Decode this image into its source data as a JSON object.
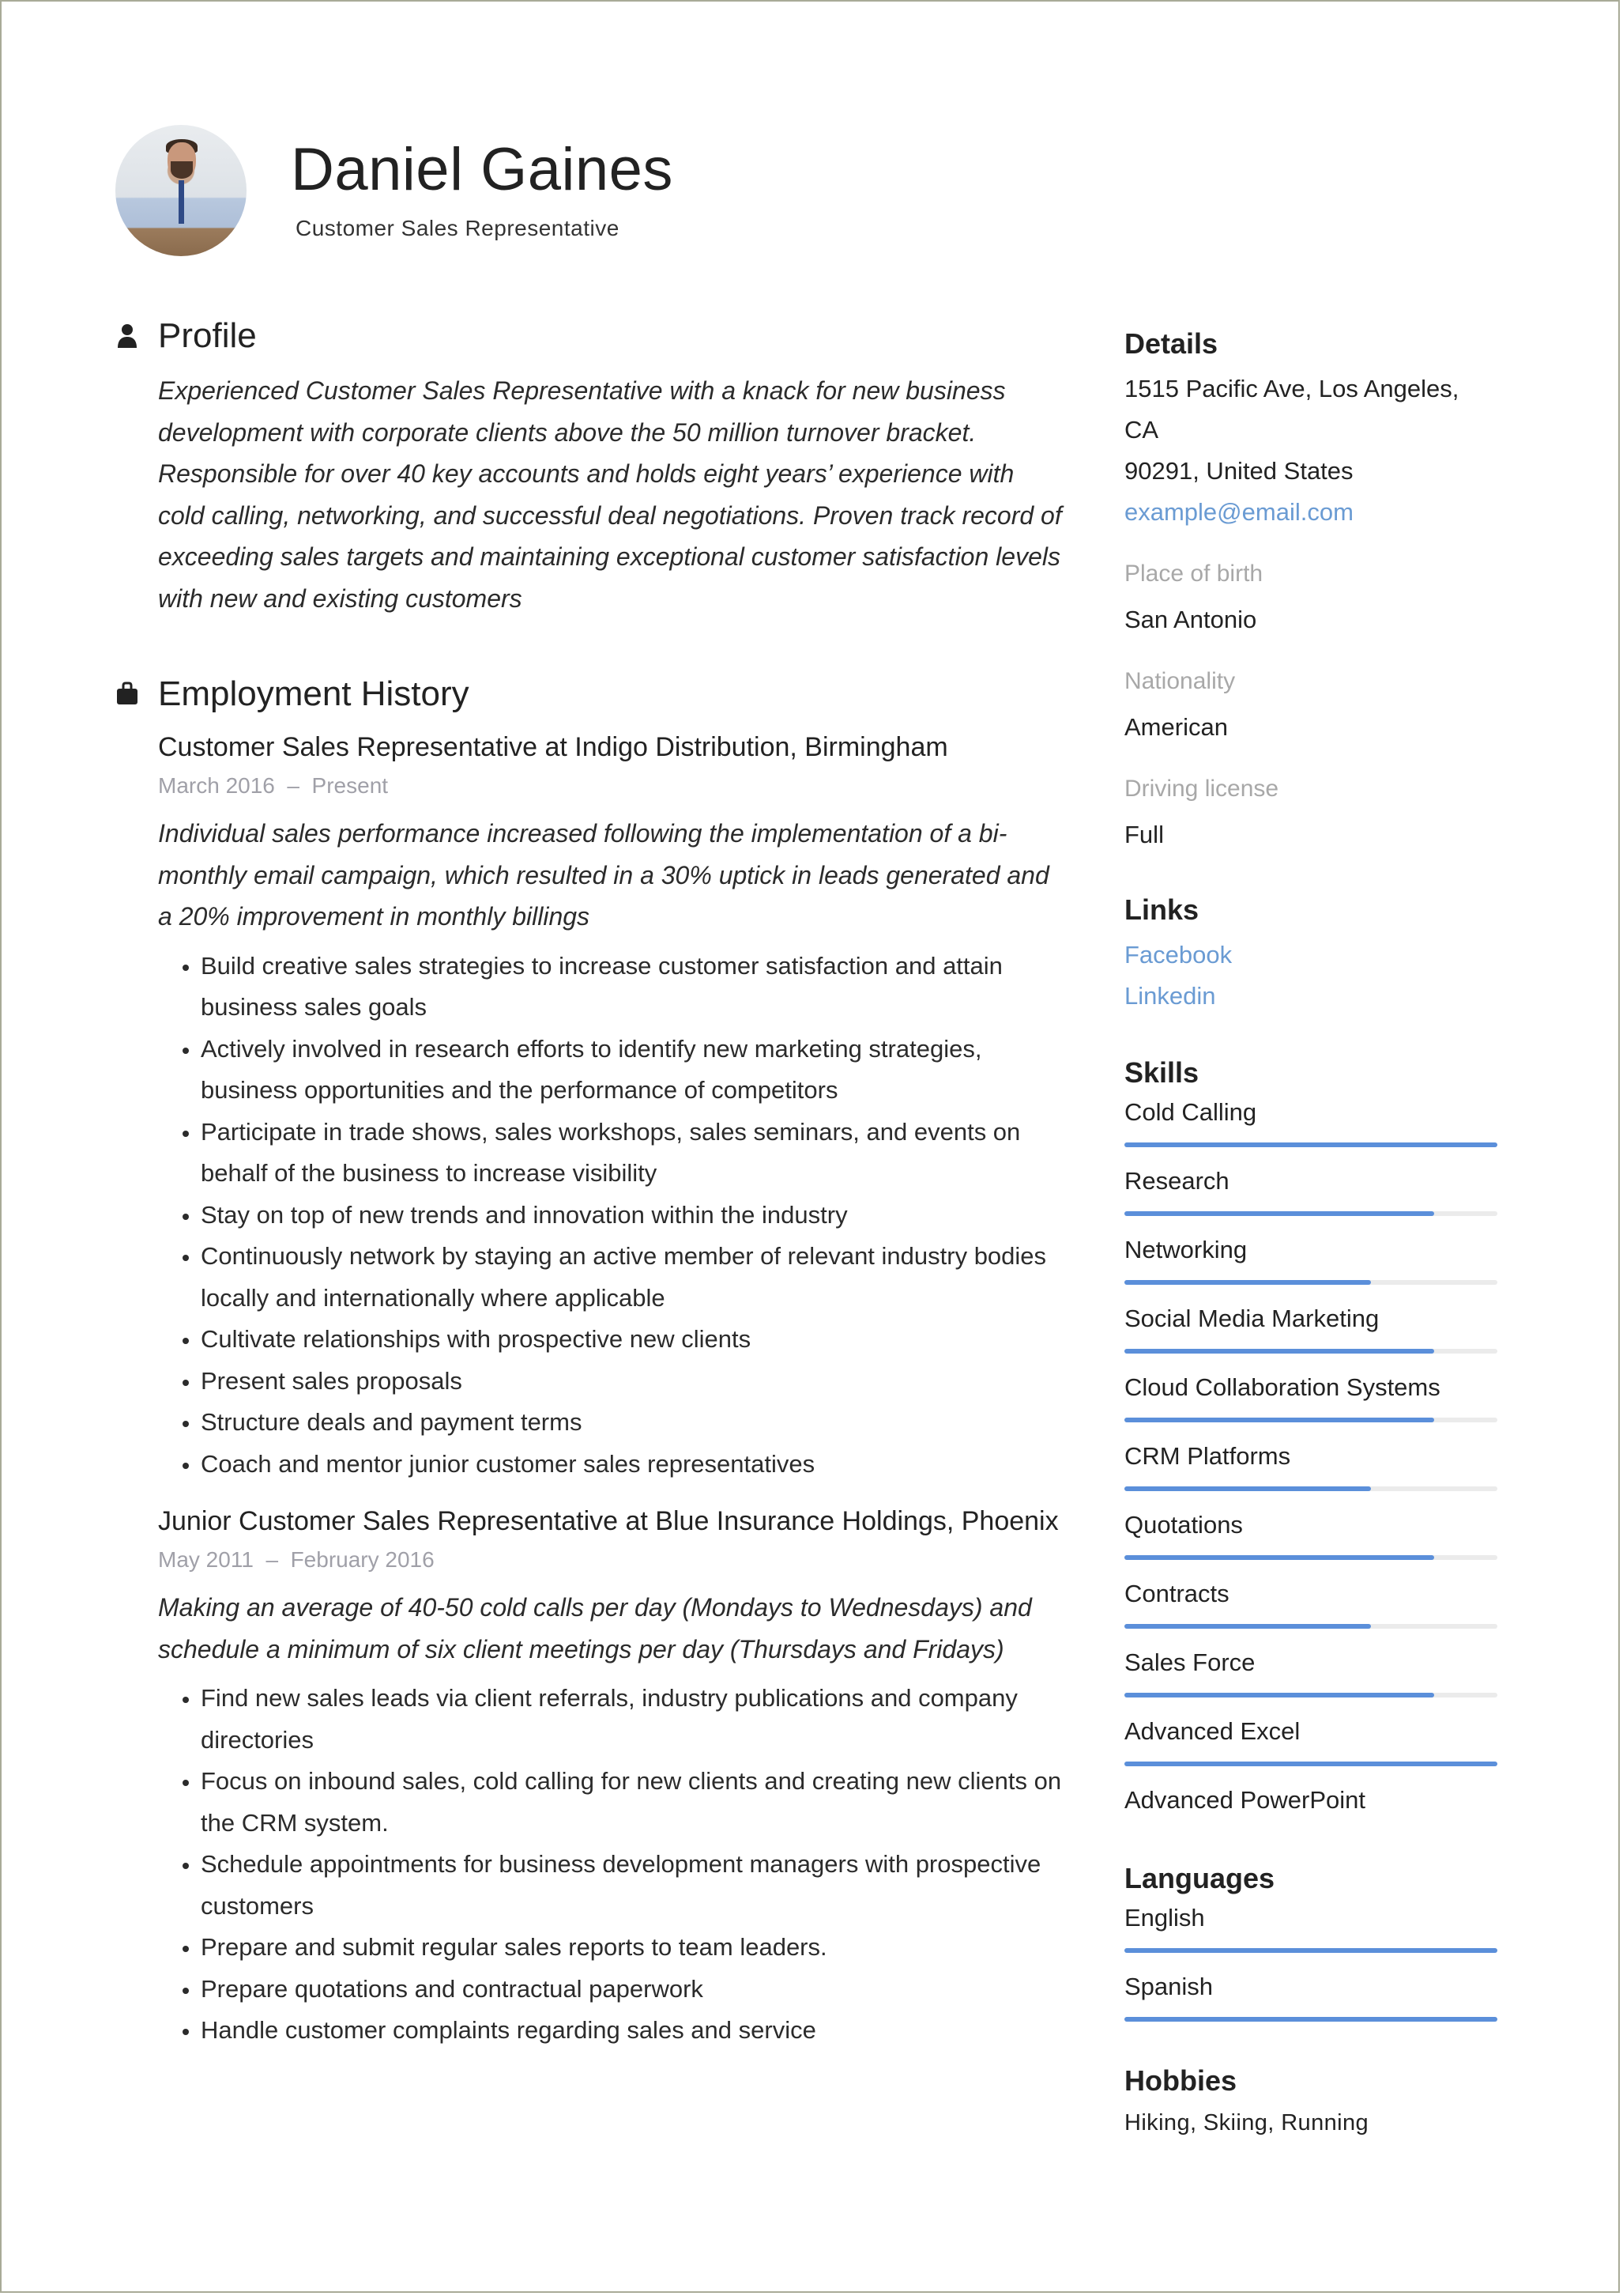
{
  "header": {
    "name": "Daniel Gaines",
    "title": "Customer Sales Representative"
  },
  "profile": {
    "heading": "Profile",
    "icon": "person-icon",
    "text": "Experienced Customer Sales Representative with a knack for new business development with corporate clients above the 50 million turnover bracket. Responsible for over 40 key accounts and holds eight years’ experience with cold calling, networking, and successful deal negotiations. Proven track record of exceeding sales targets and maintaining exceptional customer satisfaction levels with new and existing customers"
  },
  "employment": {
    "heading": "Employment History",
    "icon": "briefcase-icon",
    "jobs": [
      {
        "title": "Customer Sales Representative at Indigo Distribution, Birmingham",
        "dates": "March 2016  –  Present",
        "description": "Individual sales performance increased following the implementation of a bi-monthly email campaign, which resulted in a 30% uptick in leads generated and a 20% improvement in monthly billings",
        "bullets": [
          "Build creative sales strategies to increase customer satisfaction and attain business sales goals",
          "Actively involved in research efforts to identify new marketing strategies, business opportunities and the performance of competitors",
          "Participate in trade shows, sales workshops, sales seminars, and events on behalf of the business to increase visibility",
          "Stay on top of new trends and innovation within the industry",
          "Continuously network by staying an active member of relevant industry bodies locally and internationally where applicable",
          "Cultivate relationships with prospective new clients",
          "Present sales proposals",
          "Structure deals and payment terms",
          "Coach and mentor junior customer sales representatives"
        ]
      },
      {
        "title": "Junior Customer Sales Representative at Blue Insurance Holdings, Phoenix",
        "dates": "May 2011  –  February 2016",
        "description": "Making an average of 40-50 cold calls per day (Mondays to Wednesdays) and schedule a minimum of six client meetings per day (Thursdays and Fridays)",
        "bullets": [
          "Find new sales leads via client referrals, industry publications and company directories",
          "Focus on inbound sales, cold calling for new clients and creating new clients on the CRM system.",
          "Schedule appointments for business development managers with prospective customers",
          "Prepare and submit regular sales reports to team leaders.",
          "Prepare quotations and contractual paperwork",
          "Handle customer complaints regarding sales and service"
        ]
      }
    ]
  },
  "details": {
    "heading": "Details",
    "address_line1": "1515 Pacific Ave, Los Angeles, CA",
    "address_line2": "90291, United States",
    "email": "example@email.com",
    "place_of_birth_label": "Place of birth",
    "place_of_birth": "San Antonio",
    "nationality_label": "Nationality",
    "nationality": "American",
    "driving_license_label": "Driving license",
    "driving_license": "Full"
  },
  "links": {
    "heading": "Links",
    "items": [
      "Facebook",
      "Linkedin"
    ]
  },
  "skills": {
    "heading": "Skills",
    "bar_color": "#5b8fda",
    "items": [
      {
        "name": "Cold Calling",
        "level": 1.0
      },
      {
        "name": "Research",
        "level": 0.83
      },
      {
        "name": "Networking",
        "level": 0.66
      },
      {
        "name": "Social Media Marketing",
        "level": 0.83
      },
      {
        "name": "Cloud Collaboration Systems",
        "level": 0.83
      },
      {
        "name": "CRM Platforms",
        "level": 0.66
      },
      {
        "name": "Quotations",
        "level": 0.83
      },
      {
        "name": "Contracts",
        "level": 0.66
      },
      {
        "name": "Sales Force",
        "level": 0.83
      },
      {
        "name": "Advanced Excel",
        "level": 1.0
      },
      {
        "name": "Advanced PowerPoint",
        "level": null
      }
    ]
  },
  "languages": {
    "heading": "Languages",
    "items": [
      {
        "name": "English",
        "level": 1.0
      },
      {
        "name": "Spanish",
        "level": 1.0
      }
    ]
  },
  "hobbies": {
    "heading": "Hobbies",
    "text": "Hiking, Skiing, Running"
  }
}
